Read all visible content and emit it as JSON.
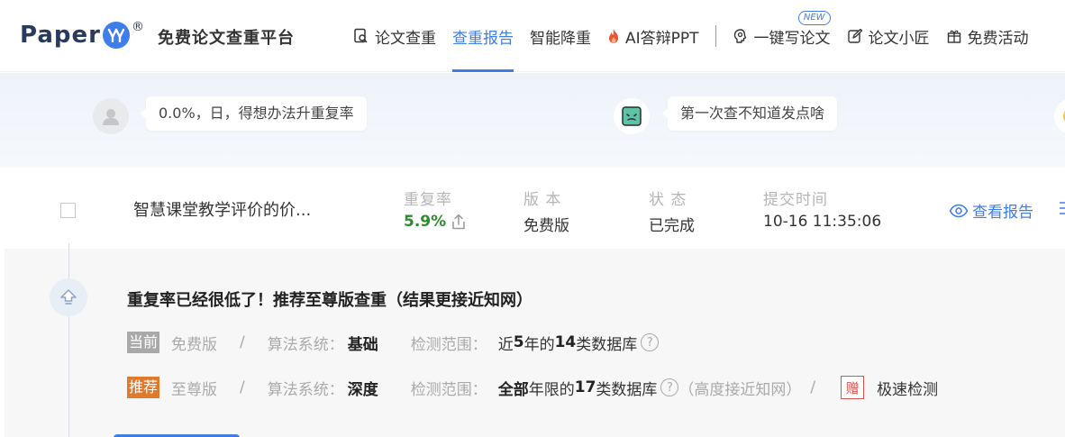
{
  "header": {
    "logo_text": "Paper",
    "logo_badge": "YY",
    "logo_reg": "®",
    "platform_name": "免费论文查重平台",
    "nav": [
      {
        "label": "论文查重",
        "icon": "search-doc-icon"
      },
      {
        "label": "查重报告",
        "icon": "",
        "active": true
      },
      {
        "label": "智能降重",
        "icon": ""
      },
      {
        "label": "AI答辩PPT",
        "icon": "fire-icon"
      },
      {
        "label": "一键写论文",
        "icon": "brain-icon",
        "badge": "NEW"
      },
      {
        "label": "论文小匠",
        "icon": "edit-icon"
      },
      {
        "label": "免费活动",
        "icon": "gift-icon"
      }
    ]
  },
  "comments": [
    {
      "text": "0.0%，日，得想办法升重复率",
      "avatar_icon": "default-user-icon"
    },
    {
      "text": "第一次查不知道发点啥",
      "avatar_icon": "emoji-avatar-icon"
    }
  ],
  "report": {
    "title": "智慧课堂教学评价的价...",
    "columns": {
      "rate_head": "重复率",
      "version_head": "版 本",
      "status_head": "状 态",
      "time_head": "提交时间"
    },
    "rate": "5.9%",
    "version": "免费版",
    "status": "已完成",
    "submit_time": "10-16 11:35:06",
    "view_label": "查看报告"
  },
  "recommend": {
    "title": "重复率已经很低了！推荐至尊版查重（结果更接近知网）",
    "current": {
      "tag": "当前",
      "version": "免费版",
      "sep": "/",
      "algo_label": "算法系统：",
      "algo": "基础",
      "range_label": "检测范围：",
      "range_pre": "近",
      "range_years": "5",
      "range_mid": "年的",
      "range_count": "14",
      "range_post": "类数据库"
    },
    "suggest": {
      "tag": "推荐",
      "version": "至尊版",
      "sep": "/",
      "algo_label": "算法系统：",
      "algo": "深度",
      "range_label": "检测范围：",
      "range_all": "全部",
      "range_mid": "年限的",
      "range_count": "17",
      "range_post": "类数据库",
      "note": "（高度接近知网）",
      "sep2": "/",
      "gift_tag": "赠",
      "gift_text": "极速检测"
    }
  },
  "colors": {
    "accent": "#3f7ee8",
    "rate_green": "#2e8b2e",
    "tag_orange": "#e07a2a",
    "tag_gray": "#a9a9a9"
  }
}
